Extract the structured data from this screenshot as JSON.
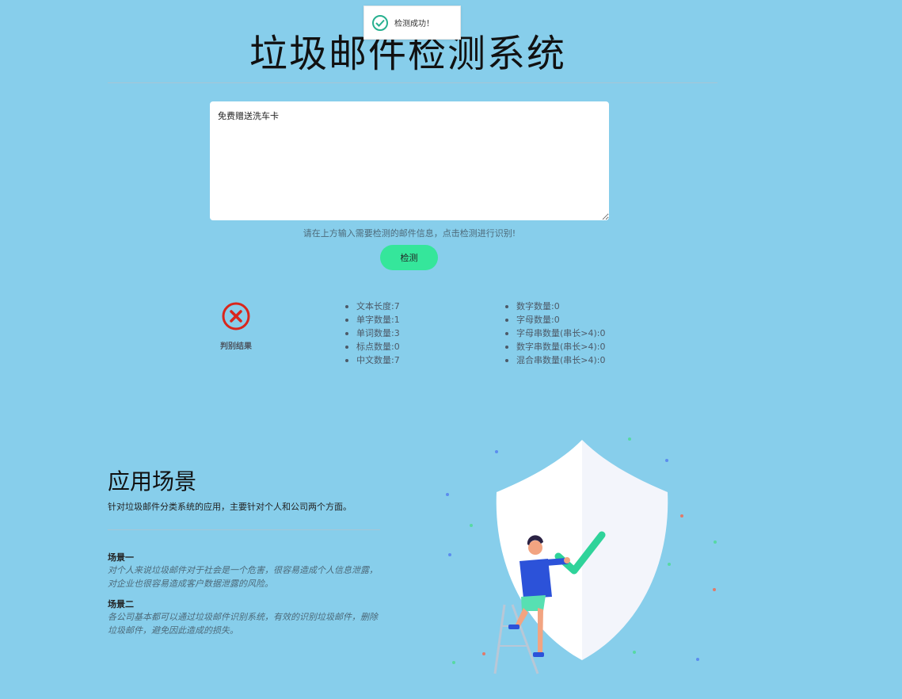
{
  "toast": {
    "message": "检测成功！"
  },
  "header": {
    "title": "垃圾邮件检测系统"
  },
  "input": {
    "value": "免费赠送洗车卡",
    "hint": "请在上方输入需要检测的邮件信息，点击检测进行识别!"
  },
  "actions": {
    "check_label": "检测"
  },
  "result": {
    "label": "判别结果",
    "verdict_color": "#d9261c",
    "stats_left": [
      "文本长度:7",
      "单字数量:1",
      "单词数量:3",
      "标点数量:0",
      "中文数量:7"
    ],
    "stats_right": [
      "数字数量:0",
      "字母数量:0",
      "字母串数量(串长>4):0",
      "数字串数量(串长>4):0",
      "混合串数量(串长>4):0"
    ]
  },
  "scenarios": {
    "title": "应用场景",
    "subtitle": "针对垃圾邮件分类系统的应用，主要针对个人和公司两个方面。",
    "items": [
      {
        "heading": "场景一",
        "text": "对个人来说垃圾邮件对于社会是一个危害，很容易造成个人信息泄露，对企业也很容易造成客户数据泄露的风险。"
      },
      {
        "heading": "场景二",
        "text": "各公司基本都可以通过垃圾邮件识别系统，有效的识别垃圾邮件，删除垃圾邮件，避免因此造成的损失。"
      }
    ]
  },
  "colors": {
    "background": "#87ceeb",
    "accent": "#35e69b",
    "check": "#2fd39a"
  }
}
